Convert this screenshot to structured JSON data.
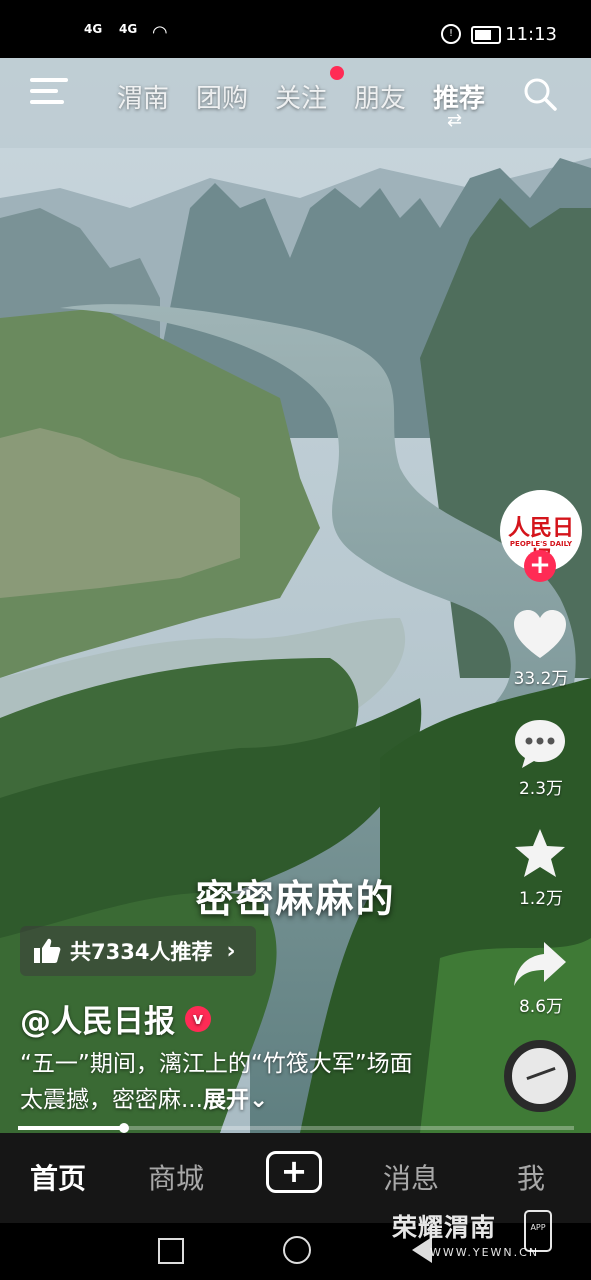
{
  "status_bar": {
    "signal1": "4G",
    "signal2": "4G",
    "time": "11:13"
  },
  "top_nav": {
    "tabs": [
      {
        "label": "渭南"
      },
      {
        "label": "团购"
      },
      {
        "label": "关注"
      },
      {
        "label": "朋友"
      },
      {
        "label": "推荐"
      }
    ],
    "active_tab": "推荐",
    "notification_dot_color": "#ff2b55"
  },
  "caption": "密密麻麻的",
  "recommend": {
    "label": "共7334人推荐",
    "chevron": "›"
  },
  "author": {
    "handle": "@人民日报",
    "verified_mark": "v"
  },
  "description": {
    "text": "“五一”期间，漓江上的“竹筏大军”场面太震撼，密密麻...",
    "more_label": "展开⌄"
  },
  "avatar": {
    "logo_text": "人民日报",
    "sub_text": "PEOPLE'S DAILY",
    "follow_label": "+"
  },
  "actions": {
    "like_count": "33.2万",
    "comment_count": "2.3万",
    "favorite_count": "1.2万",
    "share_count": "8.6万"
  },
  "progress": {
    "fraction": 0.19
  },
  "bottom_nav": {
    "tabs": [
      {
        "label": "首页"
      },
      {
        "label": "商城"
      },
      {
        "label": "消息"
      },
      {
        "label": "我"
      }
    ],
    "create_label": "+",
    "active_tab": "首页"
  },
  "watermark": {
    "title": "荣耀渭南",
    "url": "WWW.YEWN.CN",
    "app_badge": "APP"
  }
}
